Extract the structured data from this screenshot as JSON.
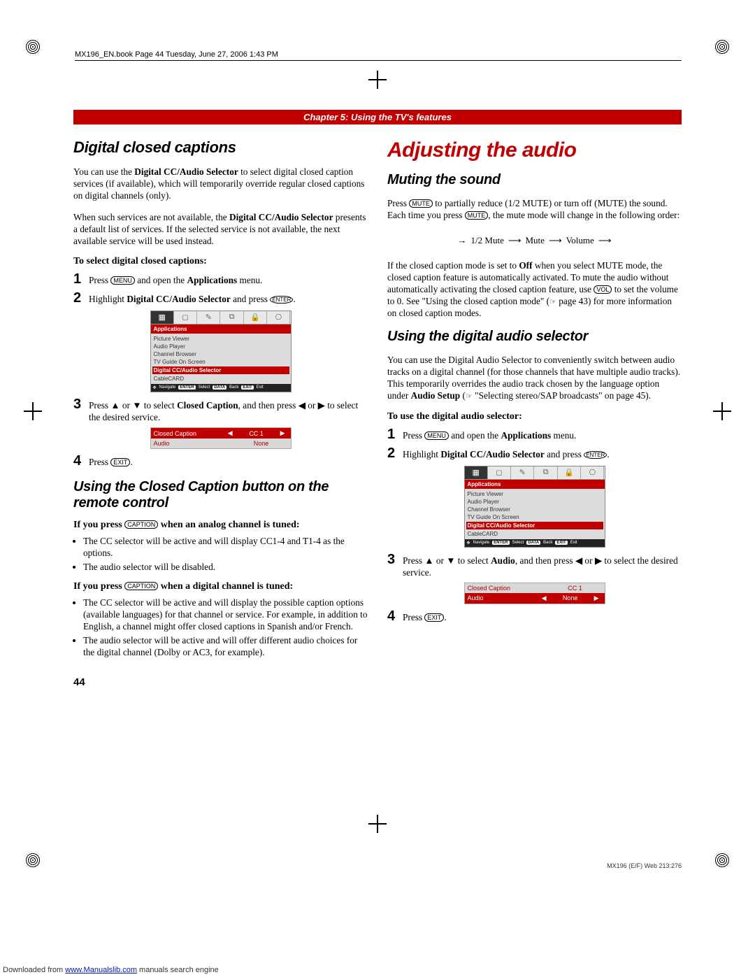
{
  "meta": {
    "book_header": "MX196_EN.book  Page 44  Tuesday, June 27, 2006  1:43 PM",
    "chapter_bar": "Chapter 5: Using the TV's features",
    "page_number": "44",
    "footer_right": "MX196 (E/F) Web 213:276",
    "download_prefix": "Downloaded from ",
    "download_link": "www.Manualslib.com",
    "download_suffix": " manuals search engine"
  },
  "buttons": {
    "menu": "MENU",
    "enter": "ENTER",
    "exit": "EXIT",
    "mute": "MUTE",
    "vol": "VOL",
    "caption": "CAPTION"
  },
  "left": {
    "h_digital_cc": "Digital closed captions",
    "p1a": "You can use the ",
    "p1b": "Digital CC/Audio Selector",
    "p1c": " to select digital closed caption services (if available), which will temporarily override regular closed captions on digital channels (only).",
    "p2a": "When such services are not available, the ",
    "p2b": "Digital CC/Audio Selector",
    "p2c": " presents a default list of services. If the selected service is not available, the next available service will be used instead.",
    "to_select": "To select digital closed captions:",
    "s1a": "Press ",
    "s1b": " and open the ",
    "s1c": "Applications",
    "s1d": " menu.",
    "s2a": "Highlight ",
    "s2b": "Digital CC/Audio Selector",
    "s2c": " and press ",
    "s2d": ".",
    "s3a": "Press ",
    "s3b": " or ",
    "s3c": " to select ",
    "s3d": "Closed Caption",
    "s3e": ", and then press ",
    "s3f": " or ",
    "s3g": " to select the desired service.",
    "s4a": "Press ",
    "s4b": ".",
    "h_ccbtn": "Using the Closed Caption button on the remote control",
    "if_analog_a": "If you press ",
    "if_analog_b": " when an analog channel is tuned:",
    "analog_b1": "The CC selector will be active and will display CC1-4 and T1-4 as the options.",
    "analog_b2": "The audio selector will be disabled.",
    "if_digital_a": "If you press ",
    "if_digital_b": " when a digital channel is tuned:",
    "digital_b1": "The CC selector will be active and will display the possible caption options (available languages) for that channel or service. For example, in addition to English, a channel might offer closed captions in Spanish and/or French.",
    "digital_b2": "The audio selector will be active and will offer different audio choices for the digital channel (Dolby or AC3, for example)."
  },
  "right": {
    "h_adjust": "Adjusting the audio",
    "h_muting": "Muting the sound",
    "mute_p1a": "Press ",
    "mute_p1b": " to partially reduce (1/2 MUTE) or turn off (MUTE) the sound. Each time you press ",
    "mute_p1c": ", the mute mode will change in the following order:",
    "flow_1": "1/2 Mute",
    "flow_2": "Mute",
    "flow_3": "Volume",
    "mute_p2a": "If the closed caption mode is set to ",
    "mute_p2_off": "Off",
    "mute_p2b": " when you select MUTE mode, the closed caption feature is automatically activated. To mute the audio without automatically activating the closed caption feature, use ",
    "mute_p2c": " to set the volume to 0. See \"Using the closed caption mode\" (",
    "mute_p2d": " page 43) for more information on closed caption modes.",
    "h_das": "Using the digital audio selector",
    "das_p1a": "You can use the Digital Audio Selector to conveniently switch between audio tracks on a digital channel (for those channels that have multiple audio tracks). This temporarily overrides the audio track chosen by the language option under ",
    "das_p1b": "Audio Setup",
    "das_p1c": " (",
    "das_p1d": " \"Selecting stereo/SAP broadcasts\" on page 45).",
    "to_use": "To use the digital audio selector:",
    "r1a": "Press ",
    "r1b": " and open the ",
    "r1c": "Applications",
    "r1d": " menu.",
    "r2a": "Highlight ",
    "r2b": "Digital CC/Audio Selector",
    "r2c": " and press ",
    "r2d": ".",
    "r3a": "Press ",
    "r3b": " or ",
    "r3c": " to select ",
    "r3d": "Audio",
    "r3e": ", and then press ",
    "r3f": " or ",
    "r3g": " to select the desired service.",
    "r4a": "Press ",
    "r4b": "."
  },
  "menu": {
    "title": "Applications",
    "items": [
      "Picture Viewer",
      "Audio Player",
      "Channel Browser",
      "TV Guide On Screen",
      "Digital CC/Audio Selector",
      "CableCARD"
    ],
    "foot_nav": "Navigate",
    "foot_sel_k": "ENTER",
    "foot_sel": "Select",
    "foot_back_k": "DATA",
    "foot_back": "Back",
    "foot_exit_k": "EXIT",
    "foot_exit": "Exit"
  },
  "selector_left": {
    "r1_label": "Closed Caption",
    "r1_val": "CC 1",
    "r2_label": "Audio",
    "r2_val": "None"
  },
  "selector_right": {
    "r1_label": "Closed Caption",
    "r1_val": "CC 1",
    "r2_label": "Audio",
    "r2_val": "None"
  }
}
